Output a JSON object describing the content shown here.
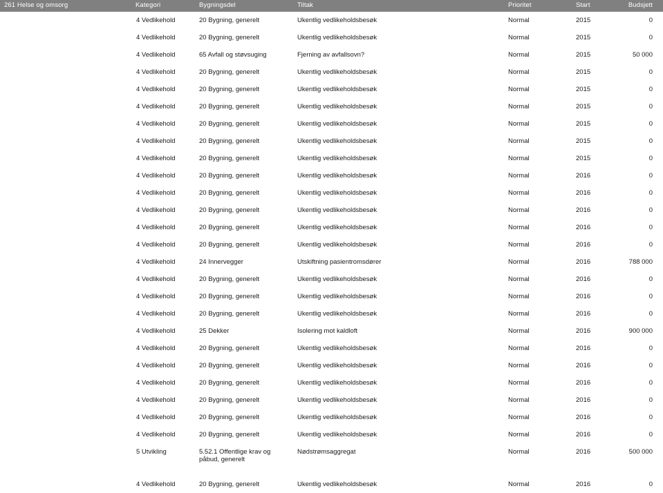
{
  "report": {
    "group_title": "261 Helse og omsorg",
    "columns": [
      {
        "key": "group",
        "label": "",
        "align": "left"
      },
      {
        "key": "kategori",
        "label": "Kategori",
        "align": "left"
      },
      {
        "key": "bygningsdel",
        "label": "Bygningsdel",
        "align": "left"
      },
      {
        "key": "tiltak",
        "label": "Tiltak",
        "align": "left"
      },
      {
        "key": "prioritet",
        "label": "Prioritet",
        "align": "left"
      },
      {
        "key": "start",
        "label": "Start",
        "align": "left"
      },
      {
        "key": "budsjett",
        "label": "Budsjett",
        "align": "right"
      }
    ],
    "header": {
      "col_kategori": "Kategori",
      "col_bygningsdel": "Bygningsdel",
      "col_tiltak": "Tiltak",
      "col_prioritet": "Prioritet",
      "col_start": "Start",
      "col_budsjett": "Budsjett"
    },
    "colors": {
      "header_bg": "#808080",
      "header_text": "#ffffff",
      "body_text": "#1a1a1a",
      "page_bg": "#ffffff"
    },
    "rows": [
      {
        "kategori": "4 Vedlikehold",
        "bygningsdel": "20 Bygning, generelt",
        "tiltak": "Ukentlig vedlikeholdsbesøk",
        "prioritet": "Normal",
        "start": "2015",
        "budsjett": "0"
      },
      {
        "kategori": "4 Vedlikehold",
        "bygningsdel": "20 Bygning, generelt",
        "tiltak": "Ukentlig vedlikeholdsbesøk",
        "prioritet": "Normal",
        "start": "2015",
        "budsjett": "0"
      },
      {
        "kategori": "4 Vedlikehold",
        "bygningsdel": "65 Avfall og støvsuging",
        "tiltak": "Fjerning av avfallsovn?",
        "prioritet": "Normal",
        "start": "2015",
        "budsjett": "50 000"
      },
      {
        "kategori": "4 Vedlikehold",
        "bygningsdel": "20 Bygning, generelt",
        "tiltak": "Ukentlig vedlikeholdsbesøk",
        "prioritet": "Normal",
        "start": "2015",
        "budsjett": "0"
      },
      {
        "kategori": "4 Vedlikehold",
        "bygningsdel": "20 Bygning, generelt",
        "tiltak": "Ukentlig vedlikeholdsbesøk",
        "prioritet": "Normal",
        "start": "2015",
        "budsjett": "0"
      },
      {
        "kategori": "4 Vedlikehold",
        "bygningsdel": "20 Bygning, generelt",
        "tiltak": "Ukentlig vedlikeholdsbesøk",
        "prioritet": "Normal",
        "start": "2015",
        "budsjett": "0"
      },
      {
        "kategori": "4 Vedlikehold",
        "bygningsdel": "20 Bygning, generelt",
        "tiltak": "Ukentlig vedlikeholdsbesøk",
        "prioritet": "Normal",
        "start": "2015",
        "budsjett": "0"
      },
      {
        "kategori": "4 Vedlikehold",
        "bygningsdel": "20 Bygning, generelt",
        "tiltak": "Ukentlig vedlikeholdsbesøk",
        "prioritet": "Normal",
        "start": "2015",
        "budsjett": "0"
      },
      {
        "kategori": "4 Vedlikehold",
        "bygningsdel": "20 Bygning, generelt",
        "tiltak": "Ukentlig vedlikeholdsbesøk",
        "prioritet": "Normal",
        "start": "2015",
        "budsjett": "0"
      },
      {
        "kategori": "4 Vedlikehold",
        "bygningsdel": "20 Bygning, generelt",
        "tiltak": "Ukentlig vedlikeholdsbesøk",
        "prioritet": "Normal",
        "start": "2016",
        "budsjett": "0"
      },
      {
        "kategori": "4 Vedlikehold",
        "bygningsdel": "20 Bygning, generelt",
        "tiltak": "Ukentlig vedlikeholdsbesøk",
        "prioritet": "Normal",
        "start": "2016",
        "budsjett": "0"
      },
      {
        "kategori": "4 Vedlikehold",
        "bygningsdel": "20 Bygning, generelt",
        "tiltak": "Ukentlig vedlikeholdsbesøk",
        "prioritet": "Normal",
        "start": "2016",
        "budsjett": "0"
      },
      {
        "kategori": "4 Vedlikehold",
        "bygningsdel": "20 Bygning, generelt",
        "tiltak": "Ukentlig vedlikeholdsbesøk",
        "prioritet": "Normal",
        "start": "2016",
        "budsjett": "0"
      },
      {
        "kategori": "4 Vedlikehold",
        "bygningsdel": "20 Bygning, generelt",
        "tiltak": "Ukentlig vedlikeholdsbesøk",
        "prioritet": "Normal",
        "start": "2016",
        "budsjett": "0"
      },
      {
        "kategori": "4 Vedlikehold",
        "bygningsdel": "24 Innervegger",
        "tiltak": "Utskiftning pasientromsdører",
        "prioritet": "Normal",
        "start": "2016",
        "budsjett": "788 000"
      },
      {
        "kategori": "4 Vedlikehold",
        "bygningsdel": "20 Bygning, generelt",
        "tiltak": "Ukentlig vedlikeholdsbesøk",
        "prioritet": "Normal",
        "start": "2016",
        "budsjett": "0"
      },
      {
        "kategori": "4 Vedlikehold",
        "bygningsdel": "20 Bygning, generelt",
        "tiltak": "Ukentlig vedlikeholdsbesøk",
        "prioritet": "Normal",
        "start": "2016",
        "budsjett": "0"
      },
      {
        "kategori": "4 Vedlikehold",
        "bygningsdel": "20 Bygning, generelt",
        "tiltak": "Ukentlig vedlikeholdsbesøk",
        "prioritet": "Normal",
        "start": "2016",
        "budsjett": "0"
      },
      {
        "kategori": "4 Vedlikehold",
        "bygningsdel": "25 Dekker",
        "tiltak": "Isolering mot kaldloft",
        "prioritet": "Normal",
        "start": "2016",
        "budsjett": "900 000"
      },
      {
        "kategori": "4 Vedlikehold",
        "bygningsdel": "20 Bygning, generelt",
        "tiltak": "Ukentlig vedlikeholdsbesøk",
        "prioritet": "Normal",
        "start": "2016",
        "budsjett": "0"
      },
      {
        "kategori": "4 Vedlikehold",
        "bygningsdel": "20 Bygning, generelt",
        "tiltak": "Ukentlig vedlikeholdsbesøk",
        "prioritet": "Normal",
        "start": "2016",
        "budsjett": "0"
      },
      {
        "kategori": "4 Vedlikehold",
        "bygningsdel": "20 Bygning, generelt",
        "tiltak": "Ukentlig vedlikeholdsbesøk",
        "prioritet": "Normal",
        "start": "2016",
        "budsjett": "0"
      },
      {
        "kategori": "4 Vedlikehold",
        "bygningsdel": "20 Bygning, generelt",
        "tiltak": "Ukentlig vedlikeholdsbesøk",
        "prioritet": "Normal",
        "start": "2016",
        "budsjett": "0"
      },
      {
        "kategori": "4 Vedlikehold",
        "bygningsdel": "20 Bygning, generelt",
        "tiltak": "Ukentlig vedlikeholdsbesøk",
        "prioritet": "Normal",
        "start": "2016",
        "budsjett": "0"
      },
      {
        "kategori": "4 Vedlikehold",
        "bygningsdel": "20 Bygning, generelt",
        "tiltak": "Ukentlig vedlikeholdsbesøk",
        "prioritet": "Normal",
        "start": "2016",
        "budsjett": "0"
      },
      {
        "kategori": "5 Utvikling",
        "bygningsdel": "5.52.1 Offentlige krav og påbud, generelt",
        "tiltak": "Nødstrømsaggregat",
        "prioritet": "Normal",
        "start": "2016",
        "budsjett": "500 000",
        "tall": true
      },
      {
        "kategori": "4 Vedlikehold",
        "bygningsdel": "20 Bygning, generelt",
        "tiltak": "Ukentlig vedlikeholdsbesøk",
        "prioritet": "Normal",
        "start": "2016",
        "budsjett": "0"
      }
    ]
  }
}
